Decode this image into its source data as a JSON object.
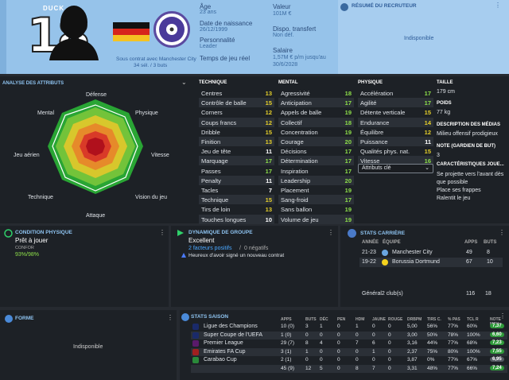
{
  "header": {
    "name": "DUCK",
    "number": "18",
    "contract": "Sous contrat avec Manchester City",
    "caps": "34 sél. / 3 buts",
    "age_label": "Âge",
    "age_value": "23 ans",
    "dob_label": "Date de naissance",
    "dob_value": "26/12/1999",
    "personality_label": "Personnalité",
    "personality_value": "Leader",
    "playtime_label": "Temps de jeu réel",
    "value_label": "Valeur",
    "value_value": "101M €",
    "transfer_label": "Dispo. transfert",
    "transfer_value": "Non déf.",
    "salary_label": "Salaire",
    "salary_value": "1,57M € p/m jusqu'au 30/6/2028",
    "scout_title": "RÉSUMÉ DU RECRUTEUR",
    "scout_value": "Indisponible"
  },
  "attributes": {
    "title": "ANALYSE DES ATTRIBUTS",
    "radar_labels": {
      "defense": "Défense",
      "physique": "Physique",
      "vitesse": "Vitesse",
      "vision": "Vision du jeu",
      "attaque": "Attaque",
      "technique": "Technique",
      "aerien": "Jeu aérien",
      "mental": "Mental"
    },
    "technique_title": "TECHNIQUE",
    "technique": [
      {
        "name": "Centres",
        "value": "13",
        "color": "#e6d02a"
      },
      {
        "name": "Contrôle de balle",
        "value": "15",
        "color": "#e6d02a"
      },
      {
        "name": "Corners",
        "value": "12",
        "color": "#e6d02a"
      },
      {
        "name": "Coups francs",
        "value": "12",
        "color": "#e6d02a"
      },
      {
        "name": "Dribble",
        "value": "15",
        "color": "#e6d02a"
      },
      {
        "name": "Finition",
        "value": "13",
        "color": "#e6d02a"
      },
      {
        "name": "Jeu de tête",
        "value": "11",
        "color": "#ffffff"
      },
      {
        "name": "Marquage",
        "value": "17",
        "color": "#8ee04a"
      },
      {
        "name": "Passes",
        "value": "17",
        "color": "#8ee04a"
      },
      {
        "name": "Penalty",
        "value": "11",
        "color": "#ffffff"
      },
      {
        "name": "Tacles",
        "value": "7",
        "color": "#ffffff"
      },
      {
        "name": "Technique",
        "value": "15",
        "color": "#e6d02a"
      },
      {
        "name": "Tirs de loin",
        "value": "13",
        "color": "#e6d02a"
      },
      {
        "name": "Touches longues",
        "value": "10",
        "color": "#ffffff"
      }
    ],
    "mental_title": "MENTAL",
    "mental": [
      {
        "name": "Agressivité",
        "value": "18",
        "color": "#8ee04a"
      },
      {
        "name": "Anticipation",
        "value": "17",
        "color": "#8ee04a"
      },
      {
        "name": "Appels de balle",
        "value": "19",
        "color": "#8ee04a"
      },
      {
        "name": "Collectif",
        "value": "18",
        "color": "#8ee04a"
      },
      {
        "name": "Concentration",
        "value": "19",
        "color": "#8ee04a"
      },
      {
        "name": "Courage",
        "value": "20",
        "color": "#8ee04a"
      },
      {
        "name": "Décisions",
        "value": "17",
        "color": "#8ee04a"
      },
      {
        "name": "Détermination",
        "value": "17",
        "color": "#8ee04a"
      },
      {
        "name": "Inspiration",
        "value": "17",
        "color": "#8ee04a"
      },
      {
        "name": "Leadership",
        "value": "20",
        "color": "#8ee04a"
      },
      {
        "name": "Placement",
        "value": "19",
        "color": "#8ee04a"
      },
      {
        "name": "Sang-froid",
        "value": "17",
        "color": "#8ee04a"
      },
      {
        "name": "Sans ballon",
        "value": "19",
        "color": "#8ee04a"
      },
      {
        "name": "Volume de jeu",
        "value": "19",
        "color": "#8ee04a"
      }
    ],
    "physique_title": "PHYSIQUE",
    "physique": [
      {
        "name": "Accélération",
        "value": "17",
        "color": "#8ee04a"
      },
      {
        "name": "Agilité",
        "value": "17",
        "color": "#8ee04a"
      },
      {
        "name": "Détente verticale",
        "value": "15",
        "color": "#e6d02a"
      },
      {
        "name": "Endurance",
        "value": "14",
        "color": "#e6d02a"
      },
      {
        "name": "Équilibre",
        "value": "12",
        "color": "#e6d02a"
      },
      {
        "name": "Puissance",
        "value": "11",
        "color": "#ffffff"
      },
      {
        "name": "Qualités phys. nat.",
        "value": "15",
        "color": "#e6d02a"
      },
      {
        "name": "Vitesse",
        "value": "16",
        "color": "#8ee04a"
      }
    ],
    "key_attr": "Attributs clé"
  },
  "side": {
    "taille_label": "TAILLE",
    "taille_value": "179 cm",
    "poids_label": "POIDS",
    "poids_value": "77 kg",
    "media_label": "DESCRIPTION DES MÉDIAS",
    "media_value": "Milieu offensif prodigieux",
    "note_label": "NOTE (GARDIEN DE BUT)",
    "note_value": "3",
    "traits_label": "CARACTÉRISTIQUES JOUE...",
    "traits": [
      "Se projette vers l'avant dès que possible",
      "Place ses frappes",
      "Ralentit le jeu"
    ]
  },
  "condition": {
    "title": "CONDITION PHYSIQUE",
    "status": "Prêt à jouer",
    "sub": "CONFOR",
    "value": "93%/98%"
  },
  "dynamics": {
    "title": "DYNAMIQUE DE GROUPE",
    "status": "Excellent",
    "pos": "2 facteurs positifs",
    "neg": "0 négatifs",
    "note": "Heureux d'avoir signé un nouveau contrat"
  },
  "career": {
    "title": "STATS CARRIÈRE",
    "cols": {
      "year": "ANNÉE",
      "team": "ÉQUIPE",
      "apps": "APPS",
      "goals": "BUTS"
    },
    "rows": [
      {
        "year": "21-23",
        "team": "Manchester City",
        "apps": "49",
        "goals": "8"
      },
      {
        "year": "19-22",
        "team": "Borussia Dortmund",
        "apps": "67",
        "goals": "10"
      }
    ],
    "total_label": "Général2 club(s)",
    "total_apps": "116",
    "total_goals": "18"
  },
  "form": {
    "title": "FORME",
    "value": "Indisponible"
  },
  "season": {
    "title": "STATS SAISON",
    "cols": [
      "APPS",
      "BUTS",
      "DÉC",
      "PEN",
      "HDM",
      "JAUNE",
      "ROUGE",
      "DRBPM",
      "TIRS C.",
      "% PAS",
      "TCL R",
      "NOTE MOY"
    ],
    "rows": [
      {
        "comp": "Ligue des Champions",
        "cells": [
          "10 (0)",
          "3",
          "1",
          "0",
          "1",
          "0",
          "0",
          "5,00",
          "56%",
          "77%",
          "60%"
        ],
        "note": "7,37",
        "note_color": "#2f9a3a"
      },
      {
        "comp": "Super Coupe de l'UEFA",
        "cells": [
          "1 (0)",
          "0",
          "0",
          "0",
          "0",
          "0",
          "0",
          "3,00",
          "50%",
          "78%",
          "100%"
        ],
        "note": "6,60",
        "note_color": "#2f9a3a"
      },
      {
        "comp": "Premier League",
        "cells": [
          "29 (7)",
          "8",
          "4",
          "0",
          "7",
          "6",
          "0",
          "3,16",
          "44%",
          "77%",
          "68%"
        ],
        "note": "7,23",
        "note_color": "#2f9a3a"
      },
      {
        "comp": "Emirates FA Cup",
        "cells": [
          "3 (1)",
          "1",
          "0",
          "0",
          "0",
          "1",
          "0",
          "2,37",
          "75%",
          "80%",
          "100%"
        ],
        "note": "7,55",
        "note_color": "#2f9a3a"
      },
      {
        "comp": "Carabao Cup",
        "cells": [
          "2 (1)",
          "0",
          "0",
          "0",
          "0",
          "0",
          "0",
          "3,87",
          "0%",
          "77%",
          "67%"
        ],
        "note": "6,95",
        "note_color": "#555b63"
      },
      {
        "comp": "",
        "cells": [
          "45 (9)",
          "12",
          "5",
          "0",
          "8",
          "7",
          "0",
          "3,31",
          "48%",
          "77%",
          "66%"
        ],
        "note": "7,24",
        "note_color": "#2f9a3a"
      }
    ]
  }
}
